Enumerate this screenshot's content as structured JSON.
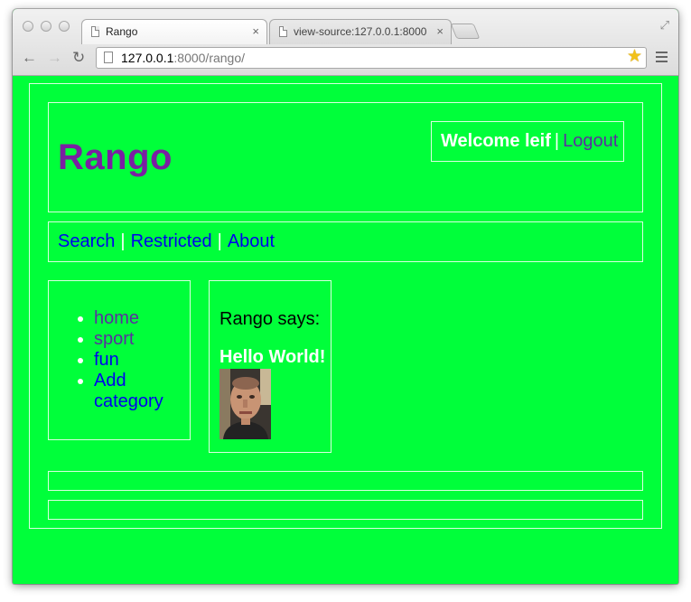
{
  "browser": {
    "tabs": [
      {
        "title": "Rango",
        "close": "×"
      },
      {
        "title": "view-source:127.0.0.1:8000",
        "close": "×"
      }
    ],
    "back": "←",
    "forward": "→",
    "reload": "↻",
    "url_host": "127.0.0.1",
    "url_rest": ":8000/rango/",
    "star": "★",
    "fullscreen": "⤢"
  },
  "header": {
    "title": "Rango",
    "welcome_text": "Welcome leif",
    "separator": "|",
    "logout_label": "Logout"
  },
  "nav": {
    "links": [
      "Search",
      "Restricted",
      "About"
    ],
    "separator": "|"
  },
  "sidebar": {
    "categories": [
      "home",
      "sport",
      "fun",
      "Add category"
    ]
  },
  "main": {
    "says": "Rango says:",
    "greeting": "Hello World!"
  },
  "colors": {
    "page_background": "#00ff3a",
    "title": "#7a1fa2",
    "link": "#0000ee",
    "visited_link": "#5a2fa0"
  },
  "icons": [
    "page-icon",
    "star-icon",
    "menu-icon",
    "fullscreen-icon"
  ]
}
